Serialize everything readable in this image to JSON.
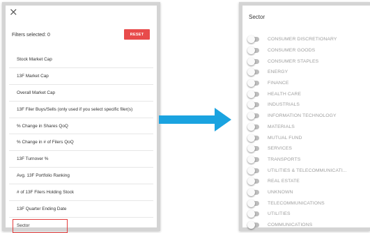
{
  "filter_panel": {
    "close_icon": "×",
    "filters_selected": "Filters selected: 0",
    "reset_label": "RESET",
    "items": [
      {
        "label": "Stock Market Cap"
      },
      {
        "label": "13F Market Cap"
      },
      {
        "label": "Overall Market Cap"
      },
      {
        "label": "13F Filer Buys/Sells (only used if you select specific filer(s)"
      },
      {
        "label": "% Change in Shares QoQ"
      },
      {
        "label": "% Change in # of Filers QoQ"
      },
      {
        "label": "13F Turnover %"
      },
      {
        "label": "Avg. 13F Portfolio Ranking"
      },
      {
        "label": "# of 13F Filers Holding Stock"
      },
      {
        "label": "13F Quarter Ending Date"
      },
      {
        "label": "Sector"
      }
    ]
  },
  "sector_panel": {
    "title": "Sector",
    "items": [
      {
        "label": "CONSUMER DISCRETIONARY"
      },
      {
        "label": "CONSUMER GOODS"
      },
      {
        "label": "CONSUMER STAPLES"
      },
      {
        "label": "ENERGY"
      },
      {
        "label": "FINANCE"
      },
      {
        "label": "HEALTH CARE"
      },
      {
        "label": "INDUSTRIALS"
      },
      {
        "label": "INFORMATION TECHNOLOGY"
      },
      {
        "label": "MATERIALS"
      },
      {
        "label": "MUTUAL FUND"
      },
      {
        "label": "SERVICES"
      },
      {
        "label": "TRANSPORTS"
      },
      {
        "label": "UTILITIES & TELECOMMUNICATI..."
      },
      {
        "label": "REAL ESTATE"
      },
      {
        "label": "UNKNOWN"
      },
      {
        "label": "TELECOMMUNICATIONS"
      },
      {
        "label": "UTILITIES"
      },
      {
        "label": "COMMUNICATIONS"
      }
    ]
  },
  "colors": {
    "reset_button": "#e84b4b",
    "highlight_border": "#e23b3b",
    "arrow": "#1aa3e0",
    "toggle_track": "#bdbdbd",
    "sector_text": "#9e9e9e"
  },
  "icons": {
    "close": "close-icon",
    "arrow": "arrow-right-icon",
    "toggle": "toggle-switch-off"
  }
}
